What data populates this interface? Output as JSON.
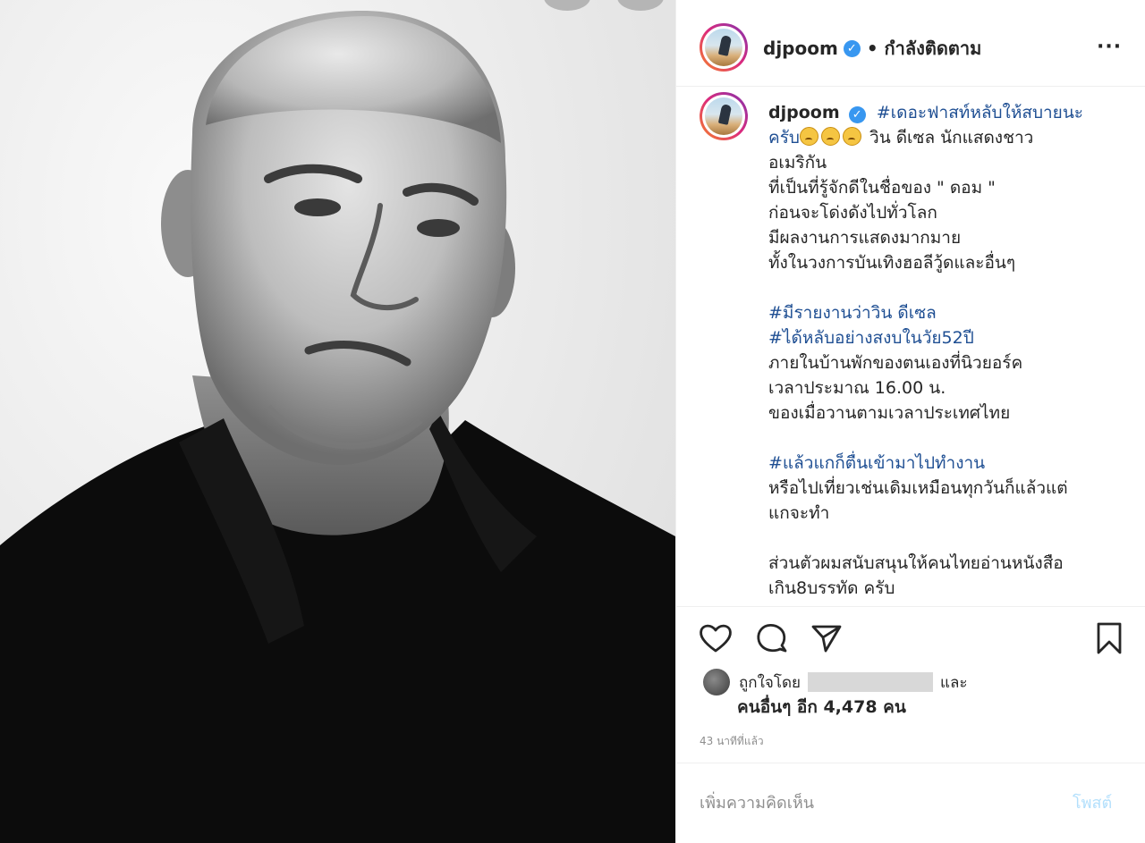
{
  "post": {
    "username": "djpoom",
    "verified_mark": "✓",
    "follow_status": "• กำลังติดตาม",
    "more_icon": "···"
  },
  "caption": {
    "username": "djpoom",
    "line1_tag": "#เดอะฟาสท์หลับให้สบายนะ",
    "line2_tag": "ครับ",
    "line2_text": " วิน ดีเซล นักแสดงชาว",
    "emoji_icon": "sad-face-emoji",
    "lines_a": [
      "อเมริกัน",
      "ที่เป็นที่รู้จักดีในชื่อของ \" ดอม \"",
      "ก่อนจะโด่งดังไปทั่วโลก",
      "มีผลงานการแสดงมากมาย",
      "ทั้งในวงการบันเทิงฮอลีวู้ดและอื่นๆ"
    ],
    "tag2": "#มีรายงานว่าวิน ดีเซล",
    "tag3": "#ได้หลับอย่างสงบในวัย52ปี",
    "lines_b": [
      "ภายในบ้านพักของตนเองที่นิวยอร์ค",
      "เวลาประมาณ 16.00 น.",
      "ของเมื่อวานตามเวลาประเทศไทย"
    ],
    "tag4": "#แล้วแกก็ตื่นเข้ามาไปทำงาน",
    "lines_c": [
      "หรือไปเที่ยวเช่นเดิมเหมือนทุกวันก็แล้วแต่",
      "แกจะทำ"
    ],
    "lines_d": [
      "ส่วนตัวผมสนับสนุนให้คนไทยอ่านหนังสือ",
      "เกิน8บรรทัด ครับ"
    ]
  },
  "likes": {
    "prefix": "ถูกใจโดย",
    "suffix": "และ",
    "count_text": "คนอื่นๆ อีก 4,478 คน"
  },
  "timestamp": "43 นาทีที่แล้ว",
  "comment": {
    "placeholder": "เพิ่มความคิดเห็น",
    "post_label": "โพสต์"
  },
  "colors": {
    "hashtag": "#1f4f93",
    "verified": "#3897f0",
    "muted": "#8e8e8e",
    "post_disabled": "#b2dffc"
  }
}
